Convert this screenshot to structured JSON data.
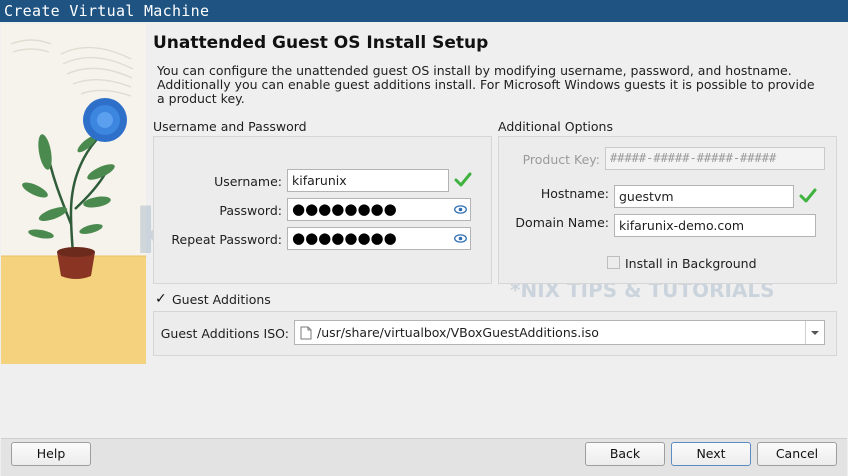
{
  "window": {
    "title": "Create Virtual Machine"
  },
  "page": {
    "heading": "Unattended Guest OS Install Setup",
    "description": "You can configure the unattended guest OS install by modifying username, password, and hostname. Additionally you can enable guest additions install. For Microsoft Windows guests it is possible to provide a product key."
  },
  "user_group": {
    "title": "Username and Password",
    "username_label": "Username:",
    "username_value": "kifarunix",
    "password_label": "Password:",
    "password_value": "●●●●●●●●",
    "repeat_label": "Repeat Password:",
    "repeat_value": "●●●●●●●●"
  },
  "options_group": {
    "title": "Additional Options",
    "product_key_label": "Product Key:",
    "product_key_value": "#####-#####-#####-#####",
    "hostname_label": "Hostname:",
    "hostname_value": "guestvm",
    "domain_label": "Domain Name:",
    "domain_value": "kifarunix-demo.com",
    "install_bg_label": "Install in Background",
    "install_bg_checked": false
  },
  "guest_additions": {
    "checkbox_label": "Guest Additions",
    "checked": true,
    "iso_label": "Guest Additions ISO:",
    "iso_value": "/usr/share/virtualbox/VBoxGuestAdditions.iso"
  },
  "buttons": {
    "help": "Help",
    "back": "Back",
    "next": "Next",
    "cancel": "Cancel"
  },
  "watermark": {
    "brand": "kifarunix",
    "tagline": "*NIX TIPS & TUTORIALS"
  },
  "colors": {
    "titlebar": "#1f5482",
    "check_green": "#3fb23f",
    "eye_blue": "#2e6fb5"
  }
}
